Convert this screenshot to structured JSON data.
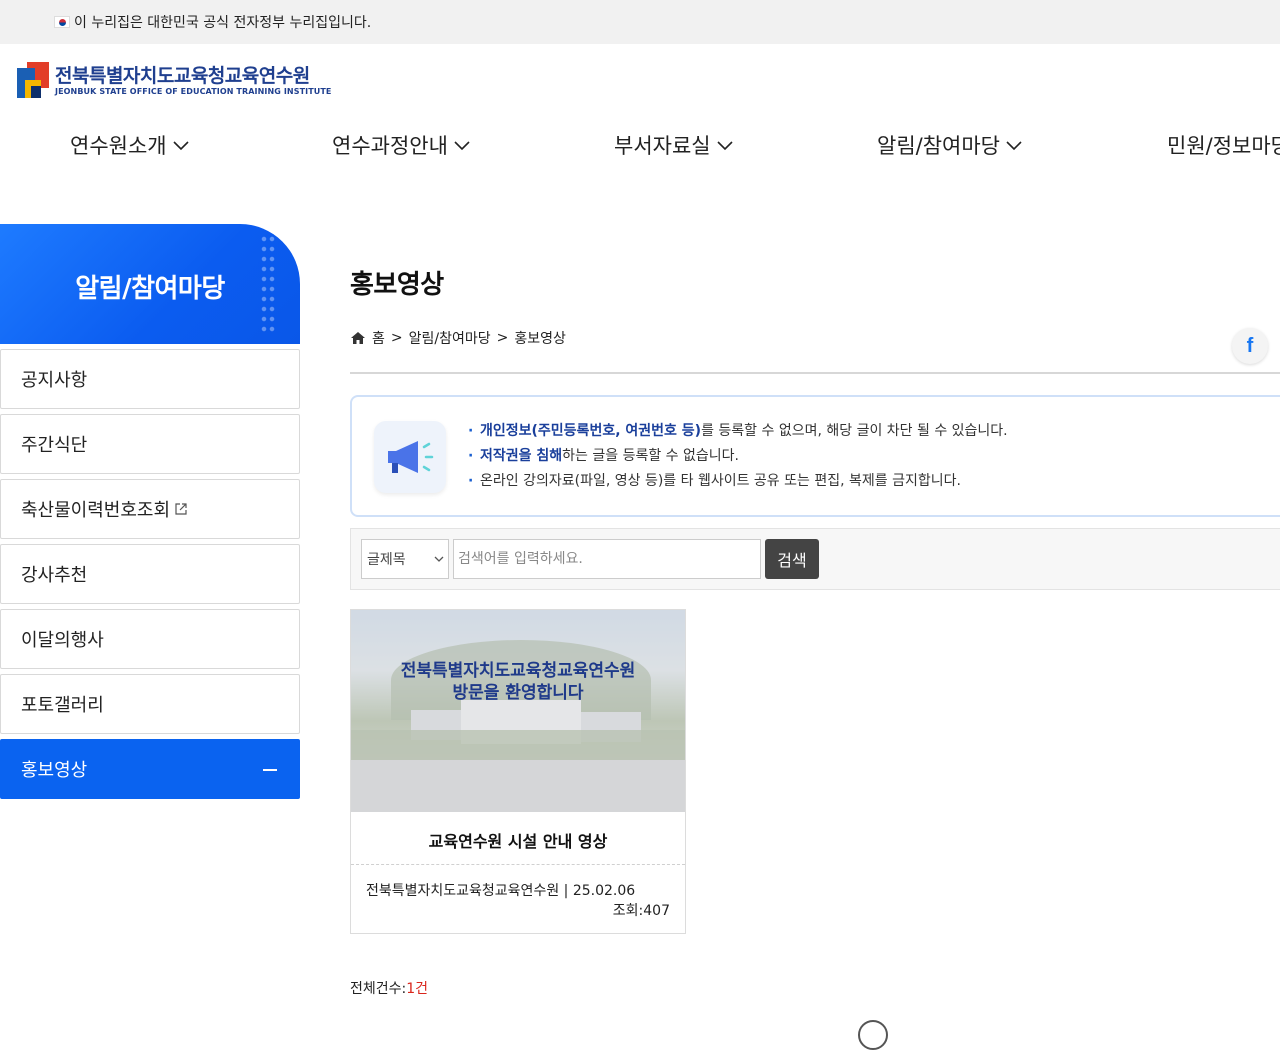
{
  "gov_banner": {
    "text": "이 누리집은 대한민국 공식 전자정부 누리집입니다."
  },
  "logo": {
    "ko": "전북특별자치도교육청교육연수원",
    "en": "JEONBUK STATE OFFICE OF EDUCATION TRAINING INSTITUTE"
  },
  "gnb": {
    "items": [
      "연수원소개",
      "연수과정안내",
      "부서자료실",
      "알림/참여마당",
      "민원/정보마당"
    ]
  },
  "sidebar": {
    "title": "알림/참여마당",
    "items": [
      "공지사항",
      "주간식단",
      "축산물이력번호조회",
      "강사추천",
      "이달의행사",
      "포토갤러리",
      "홍보영상"
    ],
    "active_index": 6
  },
  "page": {
    "title": "홍보영상"
  },
  "breadcrumb": {
    "home": "홈",
    "sep": ">",
    "section": "알림/참여마당",
    "current": "홍보영상"
  },
  "share": {
    "facebook": "f"
  },
  "notice": {
    "line1_em": "개인정보(주민등록번호, 여권번호 등)",
    "line1_rest": "를 등록할 수 없으며, 해당 글이 차단 될 수 있습니다.",
    "line2_em": "저작권을 침해",
    "line2_rest": "하는 글을 등록할 수 없습니다.",
    "line3": "온라인 강의자료(파일, 영상 등)를 타 웹사이트 공유 또는 편집, 복제를 금지합니다."
  },
  "search": {
    "select_value": "글제목",
    "placeholder": "검색어를 입력하세요.",
    "button": "검색"
  },
  "videos": [
    {
      "thumb_caption_1": "전북특별자치도교육청교육연수원",
      "thumb_caption_2": "방문을 환영합니다",
      "title": "교육연수원 시설 안내 영상",
      "meta": "전북특별자치도교육청교육연수원 | 25.02.06",
      "views": "조회:407"
    }
  ],
  "total": {
    "label": "전체건수:",
    "count": "1건"
  },
  "colors": {
    "primary": "#0a63f0",
    "accent_red": "#d9261c",
    "notice_border": "#cfe0f8"
  }
}
